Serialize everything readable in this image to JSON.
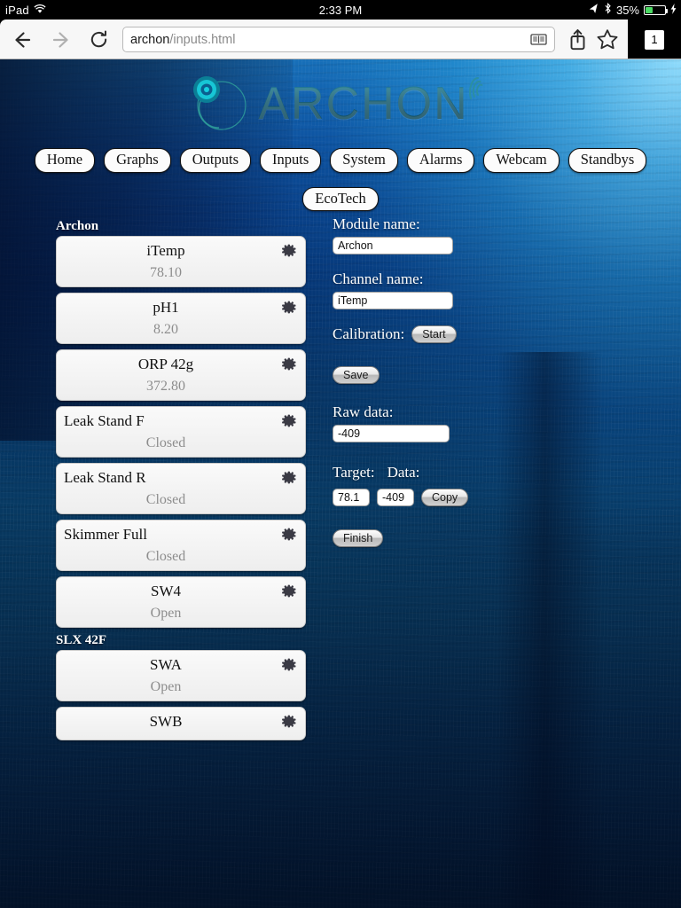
{
  "status_bar": {
    "device": "iPad",
    "wifi_icon": "wifi-icon",
    "time": "2:33 PM",
    "location_icon": "location-arrow-icon",
    "bluetooth_icon": "bluetooth-icon",
    "battery_percent": "35%",
    "battery_icon": "battery-icon",
    "charging_icon": "lightning-bolt-icon"
  },
  "browser": {
    "back_icon": "back-arrow-icon",
    "forward_icon": "forward-arrow-icon",
    "reload_icon": "reload-icon",
    "url_host": "archon",
    "url_path": "/inputs.html",
    "reader_icon": "reader-view-icon",
    "share_icon": "share-icon",
    "bookmark_icon": "bookmark-star-icon",
    "tab_count": "1"
  },
  "site": {
    "logo_text": "ARCHON",
    "logo_mark_icon": "archon-spiral-logo-icon",
    "antenna_icon": "wireless-signal-icon"
  },
  "nav": {
    "items": [
      {
        "label": "Home"
      },
      {
        "label": "Graphs"
      },
      {
        "label": "Outputs"
      },
      {
        "label": "Inputs"
      },
      {
        "label": "System"
      },
      {
        "label": "Alarms"
      },
      {
        "label": "Webcam"
      },
      {
        "label": "Standbys"
      },
      {
        "label": "EcoTech"
      }
    ]
  },
  "channel_list": {
    "groups": [
      {
        "name": "Archon",
        "channels": [
          {
            "name": "iTemp",
            "value": "78.10",
            "align": "center",
            "gear_icon": "gear-icon"
          },
          {
            "name": "pH1",
            "value": "8.20",
            "align": "center",
            "gear_icon": "gear-icon"
          },
          {
            "name": "ORP 42g",
            "value": "372.80",
            "align": "center",
            "gear_icon": "gear-icon"
          },
          {
            "name": "Leak Stand F",
            "value": "Closed",
            "align": "left",
            "gear_icon": "gear-icon"
          },
          {
            "name": "Leak Stand R",
            "value": "Closed",
            "align": "left",
            "gear_icon": "gear-icon"
          },
          {
            "name": "Skimmer Full",
            "value": "Closed",
            "align": "left",
            "gear_icon": "gear-icon"
          },
          {
            "name": "SW4",
            "value": "Open",
            "align": "center",
            "gear_icon": "gear-icon"
          }
        ]
      },
      {
        "name": "SLX 42F",
        "channels": [
          {
            "name": "SWA",
            "value": "Open",
            "align": "center",
            "gear_icon": "gear-icon"
          },
          {
            "name": "SWB",
            "value": "",
            "align": "center",
            "gear_icon": "gear-icon"
          }
        ]
      }
    ]
  },
  "form": {
    "module_label": "Module name:",
    "module_value": "Archon",
    "channel_label": "Channel name:",
    "channel_value": "iTemp",
    "calibration_label": "Calibration:",
    "start_button": "Start",
    "save_button": "Save",
    "raw_data_label": "Raw data:",
    "raw_data_value": "-409",
    "target_label": "Target:",
    "target_value": "78.1",
    "data_label": "Data:",
    "data_value": "-409",
    "copy_button": "Copy",
    "finish_button": "Finish"
  }
}
